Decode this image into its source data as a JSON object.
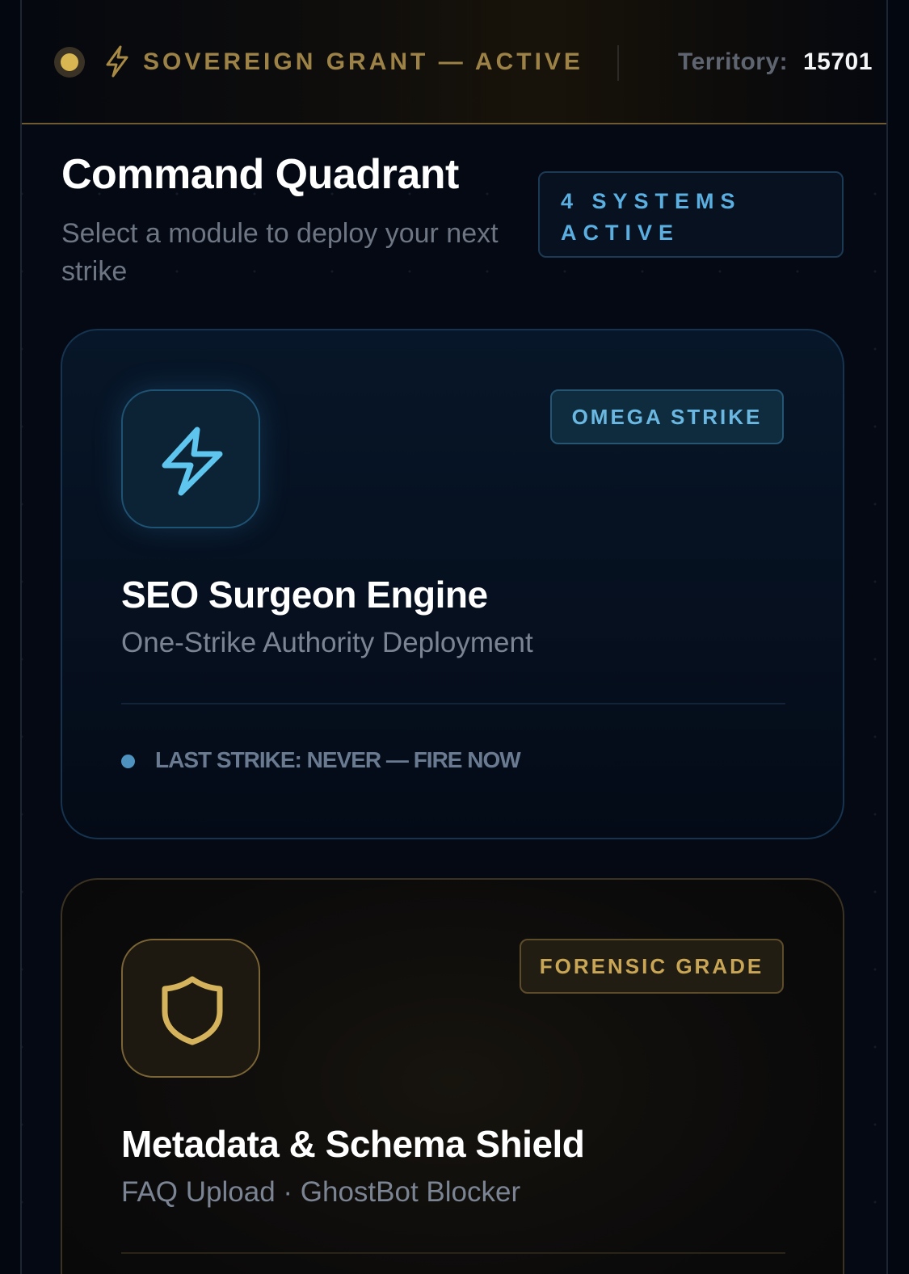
{
  "header": {
    "status_icon": "status-dot",
    "bolt_icon": "lightning-bolt-icon",
    "grant_text": "SOVEREIGN GRANT — ACTIVE",
    "territory_label": "Territory:",
    "territory_value": "15701"
  },
  "main": {
    "title": "Command Quadrant",
    "subtitle": "Select a module to deploy your next strike",
    "systems_badge": "4 SYSTEMS ACTIVE"
  },
  "modules": [
    {
      "icon": "lightning-bolt-icon",
      "tag": "OMEGA STRIKE",
      "title": "SEO Surgeon Engine",
      "subtitle": "One-Strike Authority Deployment",
      "status": "LAST STRIKE: NEVER — FIRE NOW"
    },
    {
      "icon": "shield-icon",
      "tag": "FORENSIC GRADE",
      "title": "Metadata & Schema Shield",
      "subtitle": "FAQ Upload · GhostBot Blocker"
    }
  ],
  "colors": {
    "gold_accent": "#d8b651",
    "blue_accent": "#5ec5ef",
    "background": "#040914"
  }
}
